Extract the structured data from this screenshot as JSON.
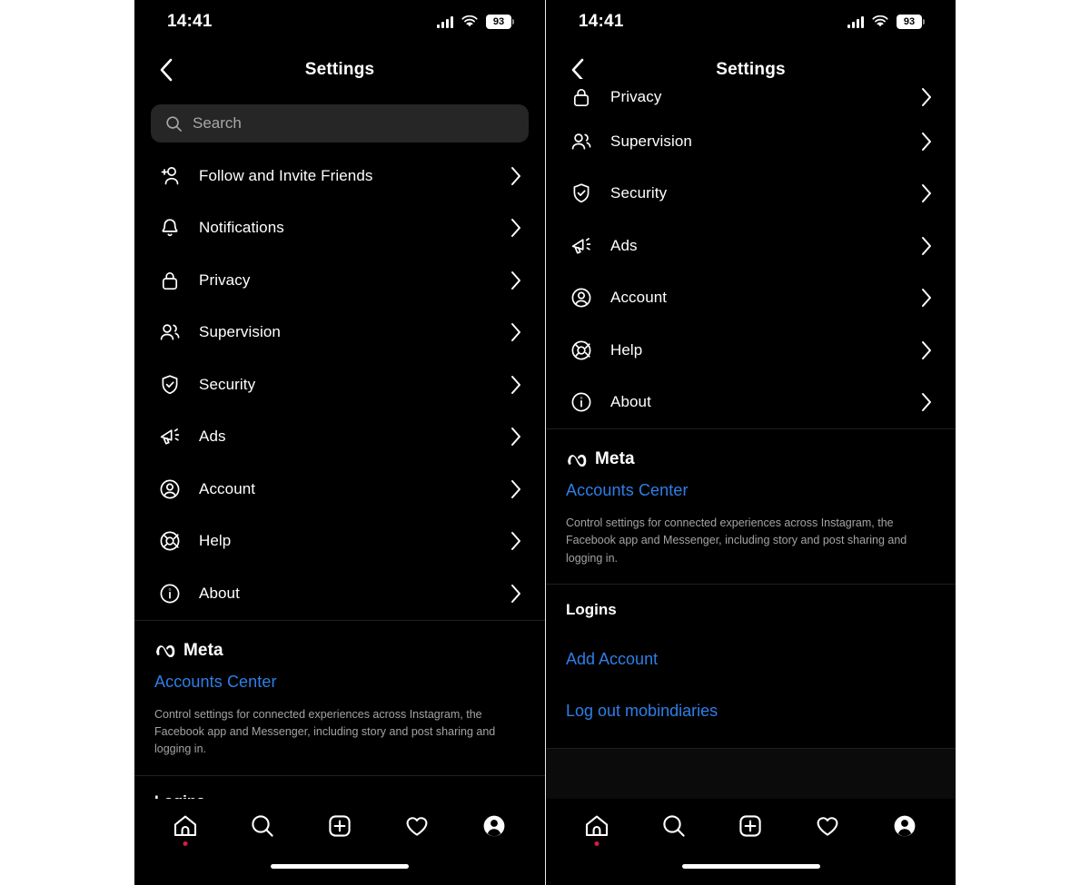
{
  "meta_info": {
    "app": "Instagram",
    "screen": "Settings",
    "accent_link_color": "#2e7fe8",
    "background_color": "#000000",
    "outer_background": "#ffffff"
  },
  "status_bar": {
    "time": "14:41",
    "battery_percent": "93",
    "cellular_icon": "cellular-signal-icon",
    "wifi_icon": "wifi-icon",
    "battery_icon": "battery-icon"
  },
  "header": {
    "title": "Settings",
    "back_icon": "chevron-left-icon"
  },
  "search": {
    "placeholder": "Search",
    "value": "",
    "icon": "search-icon"
  },
  "menu_items": [
    {
      "label": "Follow and Invite Friends",
      "icon": "person-add-icon",
      "chevron": "chevron-right-icon"
    },
    {
      "label": "Notifications",
      "icon": "bell-icon",
      "chevron": "chevron-right-icon"
    },
    {
      "label": "Privacy",
      "icon": "lock-icon",
      "chevron": "chevron-right-icon"
    },
    {
      "label": "Supervision",
      "icon": "people-icon",
      "chevron": "chevron-right-icon"
    },
    {
      "label": "Security",
      "icon": "shield-check-icon",
      "chevron": "chevron-right-icon"
    },
    {
      "label": "Ads",
      "icon": "megaphone-icon",
      "chevron": "chevron-right-icon"
    },
    {
      "label": "Account",
      "icon": "account-circle-icon",
      "chevron": "chevron-right-icon"
    },
    {
      "label": "Help",
      "icon": "lifebuoy-icon",
      "chevron": "chevron-right-icon"
    },
    {
      "label": "About",
      "icon": "info-circle-icon",
      "chevron": "chevron-right-icon"
    }
  ],
  "right_menu_items": [
    {
      "label": "Privacy",
      "icon": "lock-icon",
      "chevron": "chevron-right-icon",
      "clipped": true
    },
    {
      "label": "Supervision",
      "icon": "people-icon",
      "chevron": "chevron-right-icon"
    },
    {
      "label": "Security",
      "icon": "shield-check-icon",
      "chevron": "chevron-right-icon"
    },
    {
      "label": "Ads",
      "icon": "megaphone-icon",
      "chevron": "chevron-right-icon"
    },
    {
      "label": "Account",
      "icon": "account-circle-icon",
      "chevron": "chevron-right-icon"
    },
    {
      "label": "Help",
      "icon": "lifebuoy-icon",
      "chevron": "chevron-right-icon"
    },
    {
      "label": "About",
      "icon": "info-circle-icon",
      "chevron": "chevron-right-icon"
    }
  ],
  "meta_section": {
    "logo_icon": "meta-infinity-logo",
    "brand": "Meta",
    "accounts_center_label": "Accounts Center",
    "description": "Control settings for connected experiences across Instagram, the Facebook app and Messenger, including story and post sharing and logging in."
  },
  "logins_section": {
    "title": "Logins",
    "add_account_label": "Add Account",
    "logout_label": "Log out mobindiaries"
  },
  "tabbar": {
    "items": [
      {
        "name": "home",
        "icon": "home-icon",
        "badge": true
      },
      {
        "name": "search",
        "icon": "search-icon",
        "badge": false
      },
      {
        "name": "create",
        "icon": "plus-square-icon",
        "badge": false
      },
      {
        "name": "activity",
        "icon": "heart-icon",
        "badge": false
      },
      {
        "name": "profile",
        "icon": "profile-avatar-icon",
        "badge": false
      }
    ],
    "home_indicator": "home-indicator-bar"
  }
}
